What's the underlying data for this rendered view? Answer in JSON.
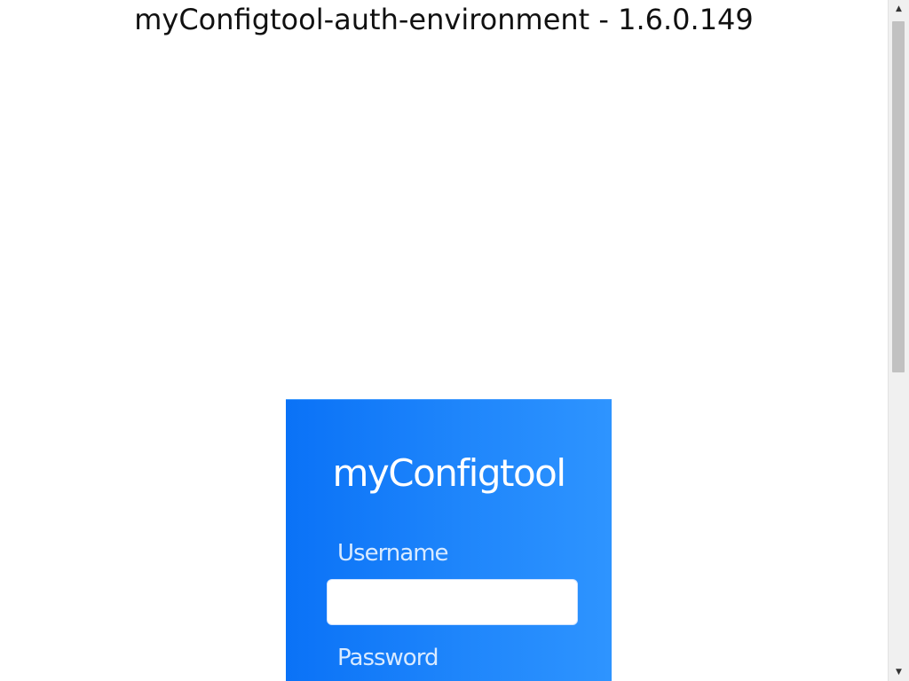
{
  "page": {
    "title": "myConfigtool-auth-environment - 1.6.0.149"
  },
  "login": {
    "brand": "myConfigtool",
    "username_label": "Username",
    "username_value": "",
    "password_label": "Password"
  },
  "colors": {
    "card_gradient_start": "#0a72f7",
    "card_gradient_end": "#2e94ff",
    "label_color": "#d8eaff",
    "scroll_thumb": "#c1c1c1"
  },
  "scrollbar": {
    "up_icon": "▲",
    "down_icon": "▼"
  }
}
